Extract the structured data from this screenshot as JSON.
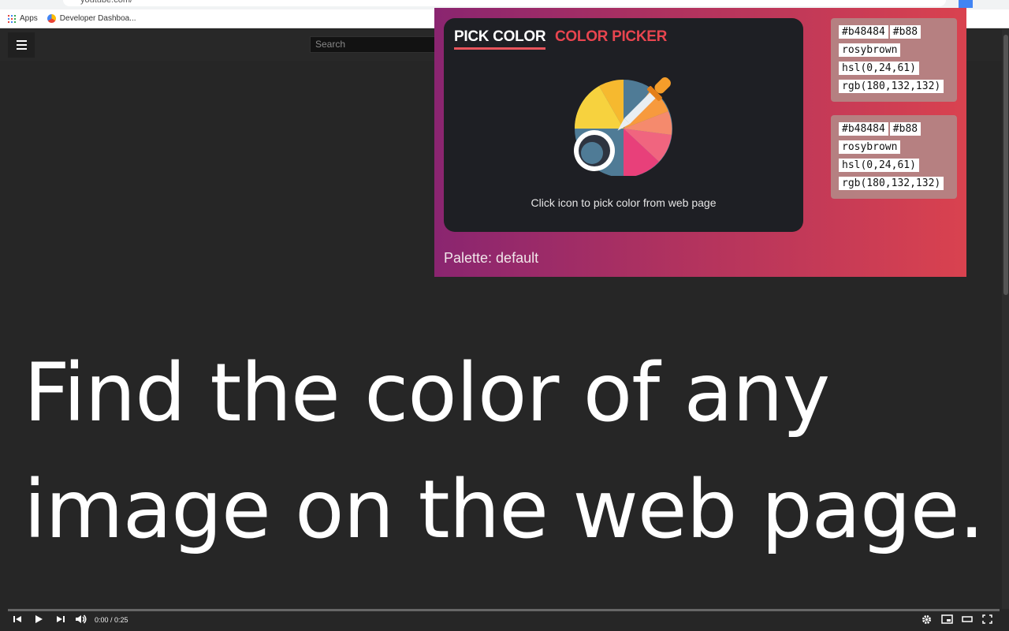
{
  "browser": {
    "url": "youtube.com/",
    "bookmarks": [
      {
        "label": "Apps",
        "icon": "apps-grid-icon"
      },
      {
        "label": "Developer Dashboa...",
        "icon": "developer-dashboard-icon"
      }
    ]
  },
  "youtube": {
    "search_placeholder": "Search"
  },
  "video": {
    "caption_line1": "Find the color of any",
    "caption_line2": "image on the web page.",
    "time": "0:00 / 0:25"
  },
  "extension": {
    "tabs": [
      {
        "label": "PICK COLOR",
        "active": true
      },
      {
        "label": "COLOR PICKER",
        "active": false
      }
    ],
    "hint": "Click icon to pick color from web page",
    "palette_label": "Palette: default",
    "swatches": [
      {
        "hex": "#b48484",
        "short": "#b88",
        "name": "rosybrown",
        "hsl": "hsl(0,24,61)",
        "rgb": "rgb(180,132,132)"
      },
      {
        "hex": "#b48484",
        "short": "#b88",
        "name": "rosybrown",
        "hsl": "hsl(0,24,61)",
        "rgb": "rgb(180,132,132)"
      }
    ]
  },
  "colors": {
    "accent": "#e8454f",
    "panel": "#1e1f24",
    "swatch": "#b48484"
  }
}
